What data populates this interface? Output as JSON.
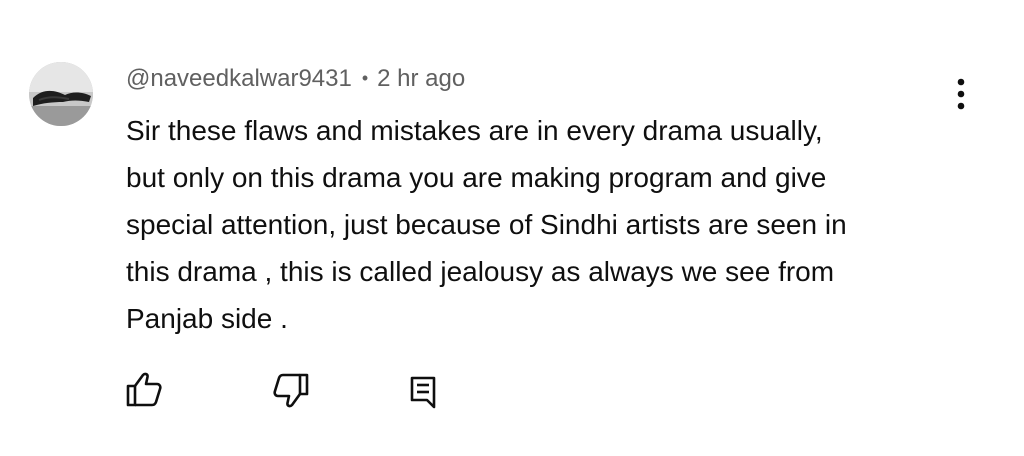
{
  "comment": {
    "author": "@naveedkalwar9431",
    "separator": "•",
    "time": "2 hr ago",
    "text": "Sir these flaws and mistakes are in every drama usually,\nbut only on this drama you are making program and give\nspecial attention, just because of Sindhi artists are seen in\nthis drama , this is called jealousy as always we see from\nPanjab side ."
  },
  "icons": {
    "avatar": "avatar-image",
    "more": "more-vertical-icon",
    "like": "thumbs-up-icon",
    "dislike": "thumbs-down-icon",
    "reply": "comment-reply-icon"
  },
  "colors": {
    "background": "#ffffff",
    "text_primary": "#0f0f0f",
    "text_secondary": "#606060"
  }
}
